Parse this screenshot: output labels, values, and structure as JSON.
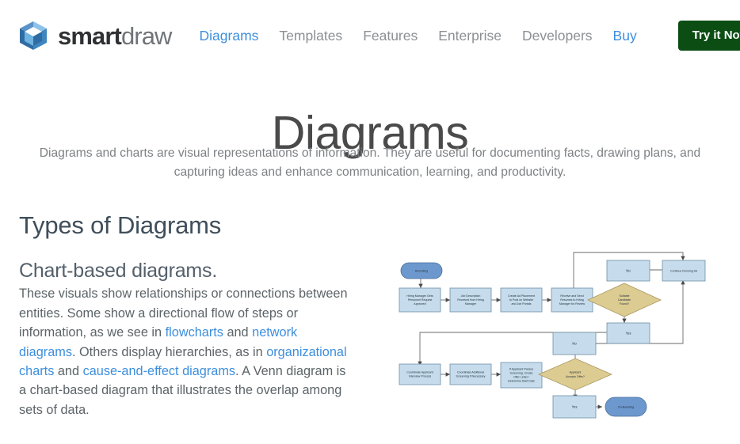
{
  "brand": {
    "name_bold": "smart",
    "name_light": "draw",
    "logo_icon": "smartdraw-cube-logo"
  },
  "nav": {
    "items": [
      {
        "label": "Diagrams",
        "state": "active"
      },
      {
        "label": "Templates",
        "state": "default"
      },
      {
        "label": "Features",
        "state": "default"
      },
      {
        "label": "Enterprise",
        "state": "default"
      },
      {
        "label": "Developers",
        "state": "default"
      },
      {
        "label": "Buy",
        "state": "link"
      }
    ],
    "cta_label": "Try it Now",
    "cta_color": "#0b4d13",
    "active_color": "#3d8fdd",
    "default_color": "#8b9094"
  },
  "hero": {
    "title": "Diagrams",
    "subtitle": "Diagrams and charts are visual representations of information. They are useful for documenting facts, drawing plans, and capturing ideas and enhance communication, learning, and productivity."
  },
  "section": {
    "heading": "Types of Diagrams",
    "subheading": "Chart-based diagrams.",
    "paragraph": {
      "p1": "These visuals show relationships or connections between entities. Some show a directional flow of steps or information, as we see in ",
      "link1": "flowcharts",
      "p2": " and ",
      "link2": "network diagrams",
      "p3": ". Others display hierarchies, as in ",
      "link3": "organizational charts",
      "p4": " and ",
      "link4": "cause-and-effect diagrams",
      "p5": ". A Venn diagram is a chart-based diagram that illustrates the overlap among sets of data."
    }
  },
  "flowchart": {
    "title": "hiring-process-flowchart",
    "colors": {
      "terminator_fill": "#6d98cd",
      "process_fill": "#c6dcec",
      "decision_fill": "#ddcc92",
      "stroke": "#6b8fa8",
      "connector": "#5a5a5a"
    },
    "nodes": [
      {
        "id": "recruiting",
        "shape": "terminator",
        "label": "Recruiting"
      },
      {
        "id": "hiring-manager-request",
        "shape": "process",
        "label": "Hiring Manager Gets Personnel Request Approved"
      },
      {
        "id": "job-description",
        "shape": "process",
        "label": "Job Description Received from Hiring Manager"
      },
      {
        "id": "create-ad",
        "shape": "process",
        "label": "Create Ad Placement to Post on Website and Job Portals"
      },
      {
        "id": "receive-resumes",
        "shape": "process",
        "label": "Receive and Send Resumes to Hiring Manager for Review"
      },
      {
        "id": "suitable-candidate",
        "shape": "decision",
        "label": "Suitable Candidate Found?"
      },
      {
        "id": "suitable-no",
        "shape": "process",
        "label": "No"
      },
      {
        "id": "continue-running-ad",
        "shape": "process",
        "label": "Continue Running Ad"
      },
      {
        "id": "suitable-yes",
        "shape": "process",
        "label": "Yes"
      },
      {
        "id": "coordinate-interview",
        "shape": "process",
        "label": "Coordinate Applicant Interview Process"
      },
      {
        "id": "additional-screening",
        "shape": "process",
        "label": "Coordinate Additional Screening if Necessary"
      },
      {
        "id": "offer-letter",
        "shape": "process",
        "label": "If Applicant Passes Screening, Create Offer Letter / Determine Start Date"
      },
      {
        "id": "accepts-offer",
        "shape": "decision",
        "label": "Applicant Accepts Offer?"
      },
      {
        "id": "offer-no",
        "shape": "process",
        "label": "No"
      },
      {
        "id": "offer-yes",
        "shape": "process",
        "label": "Yes"
      },
      {
        "id": "on-boarding",
        "shape": "terminator",
        "label": "On-Boarding"
      }
    ],
    "node_labels": {
      "recruiting": "Recruiting",
      "hiring_l1": "Hiring Manager Gets",
      "hiring_l2": "Personnel Request",
      "hiring_l3": "Approved",
      "jobdesc_l1": "Job Description",
      "jobdesc_l2": "Received from Hiring",
      "jobdesc_l3": "Manager",
      "ad_l1": "Create Ad Placement",
      "ad_l2": "to Post on Website",
      "ad_l3": "and Job Portals",
      "res_l1": "Receive and Send",
      "res_l2": "Resumes to Hiring",
      "res_l3": "Manager for Review",
      "suit_l1": "Suitable",
      "suit_l2": "Candidate",
      "suit_l3": "Found?",
      "no1": "No",
      "cont": "Continue Running Ad",
      "yes1": "Yes",
      "coord_l1": "Coordinate Applicant",
      "coord_l2": "Interview Process",
      "screen_l1": "Coordinate Additional",
      "screen_l2": "Screening if Necessary",
      "offer_l1": "If Applicant Passes",
      "offer_l2": "Screening, Create",
      "offer_l3": "Offer Letter /",
      "offer_l4": "Determine Start Date",
      "acc_l1": "Applicant",
      "acc_l2": "Accepts Offer?",
      "no2": "No",
      "yes2": "Yes",
      "onboard": "On-Boarding"
    }
  }
}
